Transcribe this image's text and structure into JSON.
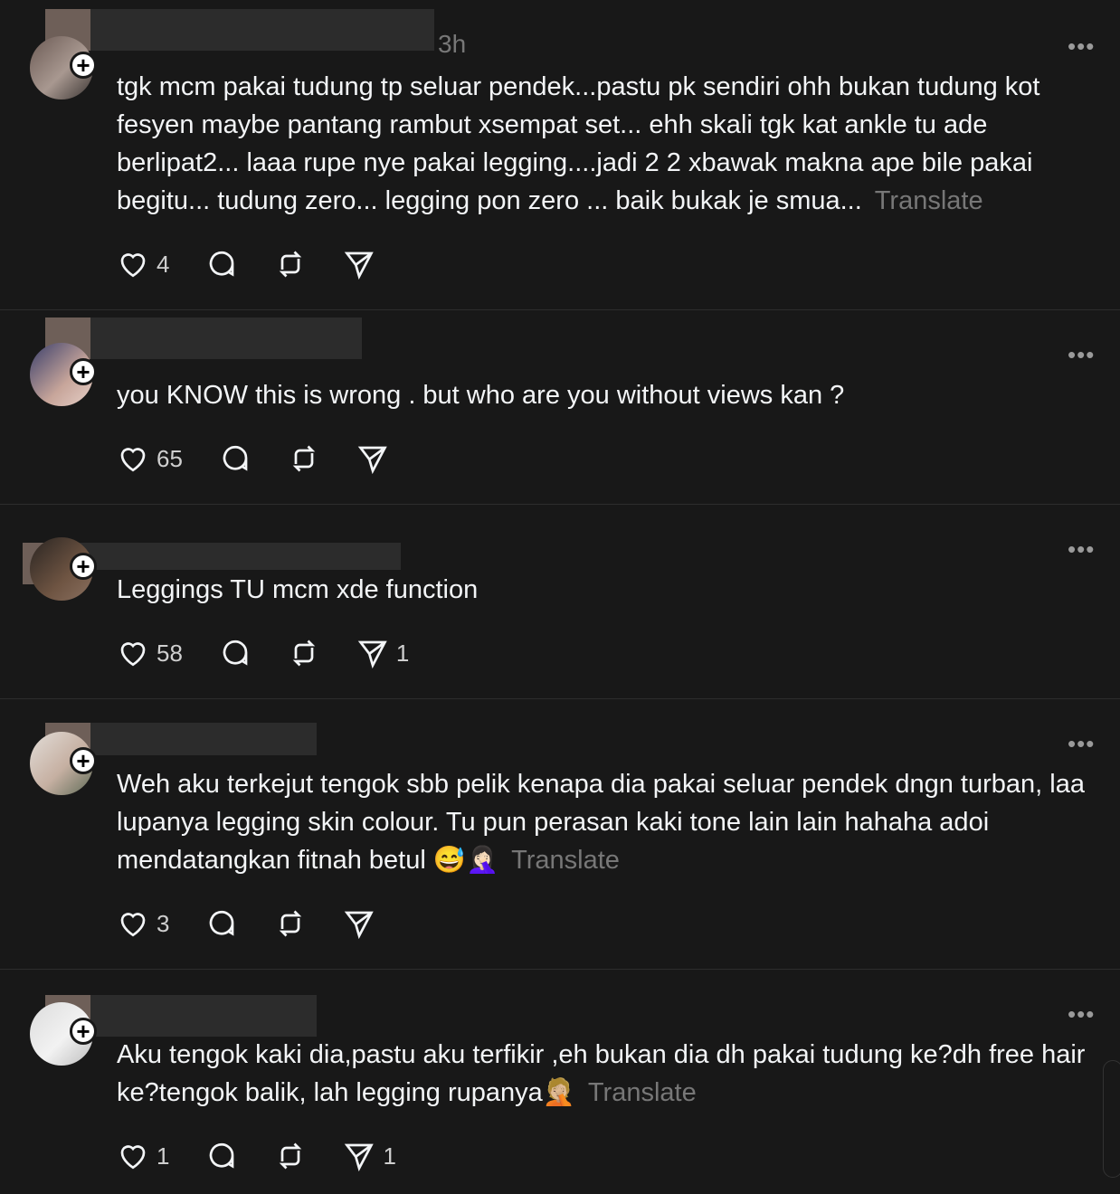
{
  "posts": [
    {
      "time": "3h",
      "text": "tgk mcm pakai tudung tp seluar pendek...pastu pk sendiri ohh bukan tudung kot fesyen maybe pantang rambut xsempat set... ehh skali tgk kat ankle tu ade berlipat2... laaa rupe nye pakai legging....jadi 2 2 xbawak makna ape bile pakai begitu... tudung zero... legging pon zero ... baik bukak je smua...",
      "translate": "Translate",
      "likes": "4",
      "shares": ""
    },
    {
      "time": "",
      "text": "you KNOW this is wrong . but who are you without views kan ?",
      "translate": "",
      "likes": "65",
      "shares": ""
    },
    {
      "time": "",
      "text": "Leggings TU mcm xde function",
      "translate": "",
      "likes": "58",
      "shares": "1"
    },
    {
      "time": "",
      "text": "Weh aku terkejut tengok sbb pelik kenapa dia pakai seluar pendek dngn turban, laa lupanya legging skin colour. Tu pun perasan kaki tone lain lain hahaha adoi mendatangkan fitnah betul 😅🤦🏻‍♀️",
      "translate": "Translate",
      "likes": "3",
      "shares": ""
    },
    {
      "time": "",
      "text": "Aku tengok kaki dia,pastu aku terfikir ,eh bukan dia dh pakai tudung ke?dh free hair ke?tengok balik, lah legging rupanya🤦🏼",
      "translate": "Translate",
      "likes": "1",
      "shares": "1"
    }
  ],
  "more_label": "•••",
  "plus_label": "+",
  "icons": [
    "heart-icon",
    "comment-icon",
    "repost-icon",
    "share-icon",
    "more-icon",
    "follow-plus-icon"
  ],
  "colors": {
    "background": "#181818",
    "text": "#f3f5f7",
    "muted": "#777777"
  }
}
